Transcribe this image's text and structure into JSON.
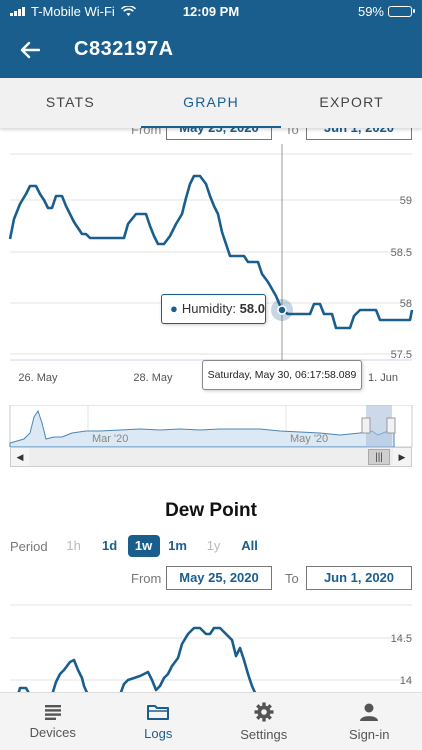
{
  "status_bar": {
    "carrier": "T-Mobile Wi-Fi",
    "time": "12:09 PM",
    "battery": "59%"
  },
  "header": {
    "title": "C832197A"
  },
  "tabs": [
    {
      "label": "STATS",
      "active": false
    },
    {
      "label": "GRAPH",
      "active": true
    },
    {
      "label": "EXPORT",
      "active": false
    }
  ],
  "humidity_range": {
    "from_label": "From",
    "from_value": "May 25, 2020",
    "to_label": "To",
    "to_value": "Jun 1, 2020"
  },
  "tooltip": {
    "series": "Humidity:",
    "value": "58.0",
    "date": "Saturday, May 30, 06:17:58.089"
  },
  "navigator": {
    "labels": [
      "Mar '20",
      "May '20"
    ]
  },
  "dew_point": {
    "title": "Dew Point",
    "period_label": "Period",
    "periods": [
      {
        "label": "1h",
        "state": "disabled"
      },
      {
        "label": "1d",
        "state": "enabled"
      },
      {
        "label": "1w",
        "state": "active"
      },
      {
        "label": "1m",
        "state": "enabled"
      },
      {
        "label": "1y",
        "state": "disabled"
      },
      {
        "label": "All",
        "state": "enabled"
      }
    ],
    "from_label": "From",
    "from_value": "May 25, 2020",
    "to_label": "To",
    "to_value": "Jun 1, 2020"
  },
  "bottom_nav": [
    {
      "label": "Devices",
      "icon": "list-icon",
      "active": false
    },
    {
      "label": "Logs",
      "icon": "folder-icon",
      "active": true
    },
    {
      "label": "Settings",
      "icon": "gear-icon",
      "active": false
    },
    {
      "label": "Sign-in",
      "icon": "person-icon",
      "active": false
    }
  ],
  "colors": {
    "brand": "#1a5e8e",
    "line": "#1a5e8e",
    "grid": "#e3e3e3"
  },
  "chart_data": [
    {
      "type": "line",
      "series": [
        {
          "name": "Humidity",
          "x": [
            "May 25 12:00",
            "May 25 14:00",
            "May 25 20:00",
            "May 26 00:00",
            "May 26 04:00",
            "May 26 07:00",
            "May 26 12:00",
            "May 26 18:00",
            "May 27 00:00",
            "May 27 06:00",
            "May 27 10:00",
            "May 27 14:00",
            "May 27 18:00",
            "May 28 00:00",
            "May 28 06:00",
            "May 28 12:00",
            "May 28 16:00",
            "May 28 20:00",
            "May 29 00:00",
            "May 29 06:00",
            "May 29 12:00",
            "May 29 18:00",
            "May 30 00:00",
            "May 30 06:17",
            "May 30 12:00",
            "May 30 18:00",
            "May 31 00:00",
            "May 31 06:00",
            "May 31 12:00",
            "May 31 18:00",
            "Jun 1 00:00",
            "Jun 1 06:00",
            "Jun 1 12:00"
          ],
          "values": [
            58.7,
            58.9,
            59.15,
            59.15,
            59.05,
            58.95,
            59.1,
            58.8,
            58.7,
            58.7,
            58.85,
            58.9,
            58.9,
            58.8,
            58.6,
            58.6,
            58.85,
            59.0,
            59.25,
            59.1,
            58.7,
            58.45,
            58.45,
            58.0,
            57.9,
            57.9,
            58.0,
            57.75,
            57.75,
            58.0,
            58.0,
            57.9,
            58.0
          ]
        }
      ],
      "y_ticks": [
        "57.5",
        "58",
        "58.5",
        "59"
      ],
      "x_ticks": [
        "26. May",
        "28. May",
        "1. Jun"
      ],
      "ylim": [
        57.5,
        59.5
      ],
      "grid": true
    },
    {
      "type": "line",
      "series": [
        {
          "name": "Dew Point",
          "x": [
            "May 25 12:00",
            "May 25 20:00",
            "May 26 04:00",
            "May 26 12:00",
            "May 26 20:00",
            "May 27 04:00",
            "May 27 12:00",
            "May 27 20:00",
            "May 28 04:00",
            "May 28 12:00",
            "May 28 20:00",
            "May 29 04:00",
            "May 29 12:00",
            "May 29 20:00",
            "May 30 04:00"
          ],
          "values": [
            13.9,
            13.85,
            13.9,
            13.7,
            14.2,
            13.8,
            13.7,
            13.9,
            14.15,
            13.9,
            14.6,
            14.6,
            14.5,
            14.35,
            13.8
          ]
        }
      ],
      "y_ticks": [
        "14",
        "14.5"
      ],
      "grid": true
    }
  ]
}
